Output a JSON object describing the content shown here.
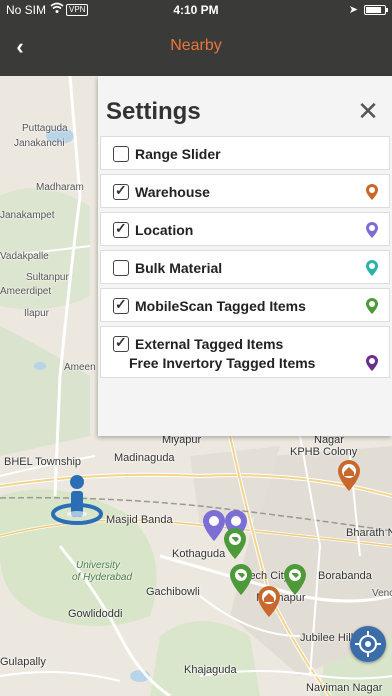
{
  "status_bar": {
    "carrier": "No SIM",
    "vpn": "VPN",
    "time": "4:10 PM",
    "battery_level": 0.85
  },
  "nav": {
    "back_icon": "chevron-left-icon",
    "title": "Nearby"
  },
  "settings": {
    "heading": "Settings",
    "close_icon": "close-icon",
    "options": [
      {
        "label": "Range Slider",
        "checked": false,
        "icon": null
      },
      {
        "label": "Warehouse",
        "checked": true,
        "icon": "warehouse-pin-icon",
        "color": "#c8682c"
      },
      {
        "label": "Location",
        "checked": true,
        "icon": "location-pin-icon",
        "color": "#7b6fd6"
      },
      {
        "label": "Bulk Material",
        "checked": false,
        "icon": "bulk-material-pin-icon",
        "color": "#2bb3a8"
      },
      {
        "label": "MobileScan Tagged Items",
        "checked": true,
        "icon": "tag-pin-icon",
        "color": "#4e9a3a"
      },
      {
        "label": "External Tagged Items",
        "sub_label": "Free Invertory Tagged Items",
        "checked": true,
        "icon": "external-tag-pin-icon",
        "color": "#6b2f8a"
      }
    ]
  },
  "map": {
    "labels": {
      "puttaguda": "Puttaguda",
      "janakanchi": "Janakanchi",
      "madharam": "Madharam",
      "janakampet": "Janakampet",
      "vadakpalle": "Vadakpalle",
      "sultanpur": "Sultanpur",
      "ameenpur_teredipet": "Ameerdipet",
      "ilapur": "Ilapur",
      "ameen": "Ameen",
      "miyapur": "Miyapur",
      "nagar": "Nagar",
      "bhel_township": "BHEL Township",
      "madinaguda": "Madinaguda",
      "kphb_colony": "KPHB Colony",
      "bharath_n": "Bharath N",
      "masjid_banda": "Masjid Banda",
      "kothaguda": "Kothaguda",
      "university": "University",
      "of_hyderabad": "of Hyderabad",
      "borabanda": "Borabanda",
      "hitech_city": "Hitech City",
      "gachibowli": "Gachibowli",
      "madhapur": "Madhapur",
      "gowlidoddi": "Gowlidoddi",
      "jubilee_hills": "Jubilee Hills",
      "gulapally": "Gulapally",
      "khajaguda": "Khajaguda",
      "navirman_nagar": "Naviman Nagar",
      "vence": "Vence"
    },
    "locate_icon": "locate-me-icon"
  }
}
